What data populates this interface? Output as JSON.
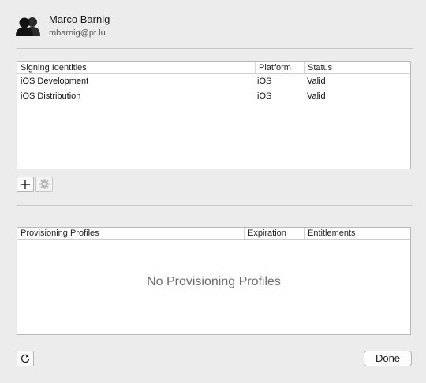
{
  "account": {
    "name": "Marco Barnig",
    "email": "mbarnig@pt.lu",
    "icon": "users-icon"
  },
  "signing_identities": {
    "columns": [
      "Signing Identities",
      "Platform",
      "Status"
    ],
    "rows": [
      {
        "name": "iOS Development",
        "platform": "iOS",
        "status": "Valid"
      },
      {
        "name": "iOS Distribution",
        "platform": "iOS",
        "status": "Valid"
      }
    ]
  },
  "identity_actions": {
    "add": "plus-icon",
    "settings": "gear-icon"
  },
  "provisioning_profiles": {
    "columns": [
      "Provisioning Profiles",
      "Expiration",
      "Entitlements"
    ],
    "empty_message": "No Provisioning Profiles"
  },
  "footer": {
    "refresh": "refresh-icon",
    "done_label": "Done"
  }
}
